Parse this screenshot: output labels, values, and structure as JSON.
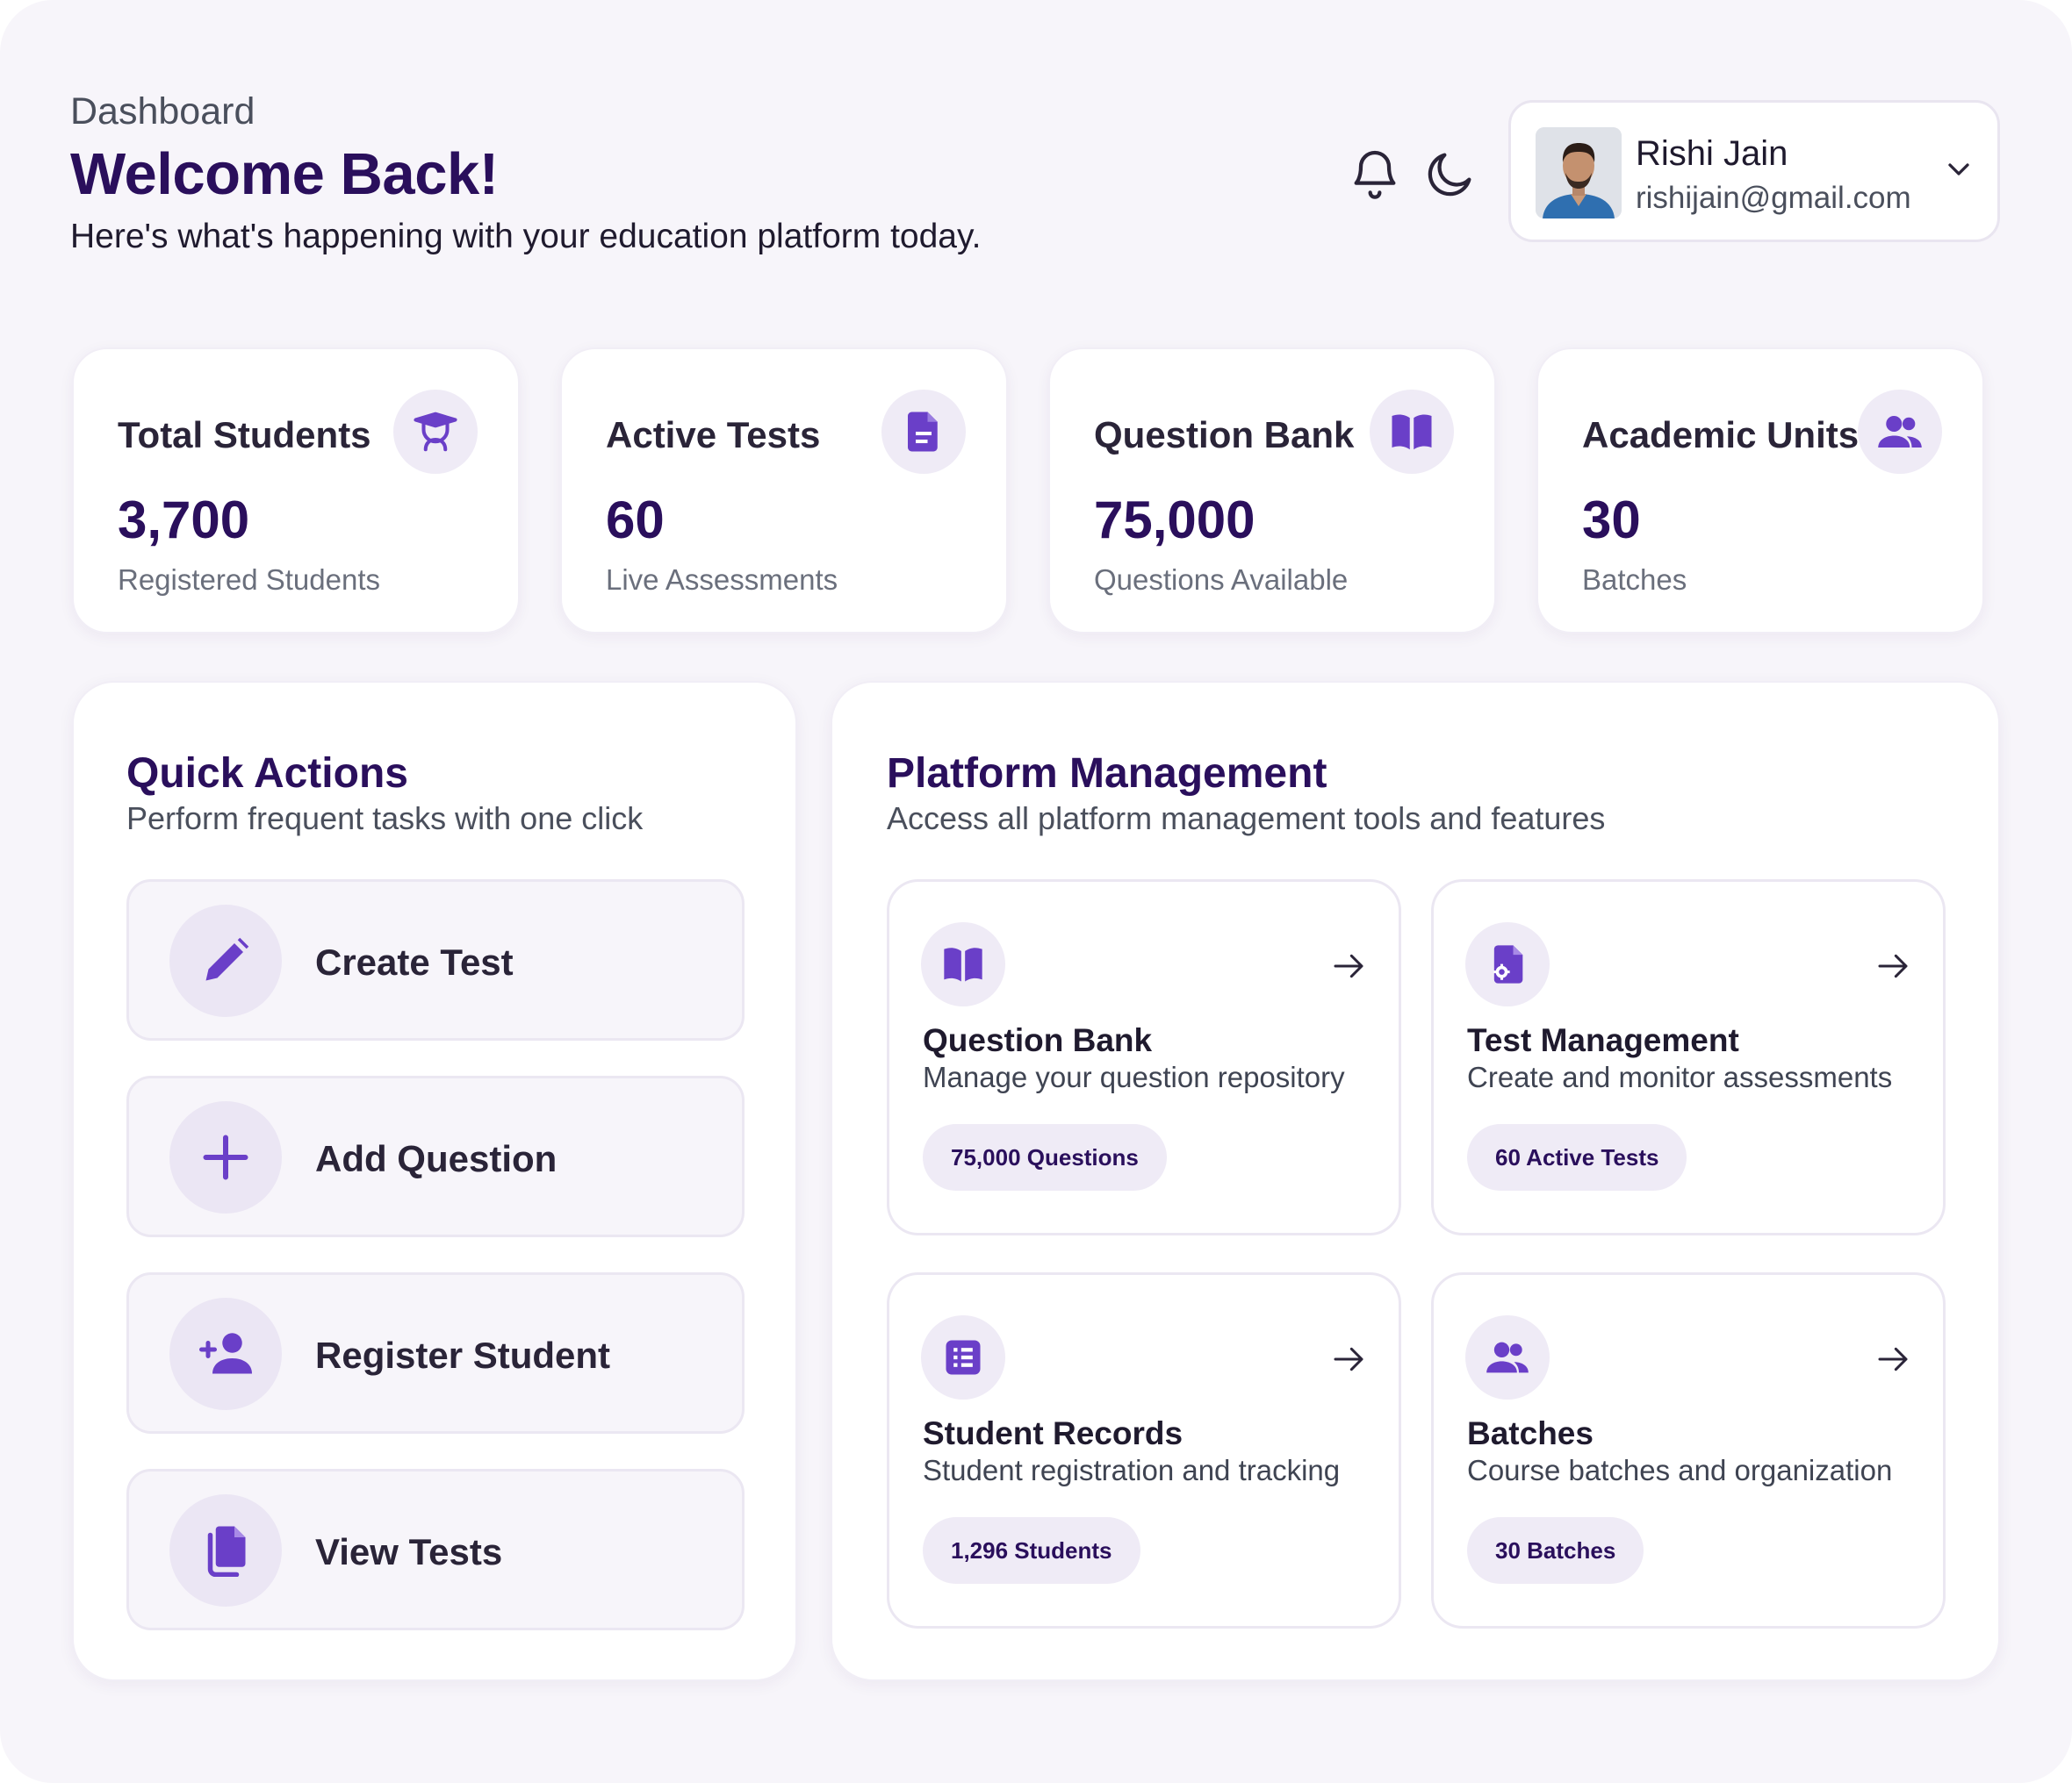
{
  "header": {
    "breadcrumb": "Dashboard",
    "title": "Welcome Back!",
    "subtitle": "Here's what's happening with your education platform today.",
    "icons": [
      "bell-icon",
      "moon-icon"
    ]
  },
  "user": {
    "name": "Rishi Jain",
    "email": "rishijain@gmail.com"
  },
  "stats": [
    {
      "title": "Total Students",
      "value": "3,700",
      "sub": "Registered Students",
      "icon": "graduate-icon"
    },
    {
      "title": "Active Tests",
      "value": "60",
      "sub": "Live Assessments",
      "icon": "document-icon"
    },
    {
      "title": "Question Bank",
      "value": "75,000",
      "sub": "Questions Available",
      "icon": "book-icon"
    },
    {
      "title": "Academic Units",
      "value": "30",
      "sub": "Batches",
      "icon": "users-icon"
    }
  ],
  "quick_actions": {
    "title": "Quick Actions",
    "subtitle": "Perform frequent tasks with one click",
    "items": [
      {
        "label": "Create Test",
        "icon": "pencil-icon"
      },
      {
        "label": "Add Question",
        "icon": "plus-icon"
      },
      {
        "label": "Register Student",
        "icon": "user-plus-icon"
      },
      {
        "label": "View Tests",
        "icon": "copy-icon"
      }
    ]
  },
  "platform": {
    "title": "Platform Management",
    "subtitle": "Access all platform management tools and features",
    "items": [
      {
        "title": "Question Bank",
        "desc": "Manage your question repository",
        "badge": "75,000 Questions",
        "icon": "book-icon"
      },
      {
        "title": "Test Management",
        "desc": "Create and monitor assessments",
        "badge": "60 Active Tests",
        "icon": "file-gear-icon"
      },
      {
        "title": "Student Records",
        "desc": "Student registration and tracking",
        "badge": "1,296 Students",
        "icon": "list-icon"
      },
      {
        "title": "Batches",
        "desc": "Course batches and organization",
        "badge": "30 Batches",
        "icon": "users-icon"
      }
    ]
  },
  "colors": {
    "accent": "#6a3fc8",
    "heading": "#2a0f5c",
    "background": "#f7f5fa",
    "icon_bg": "#efebf6"
  }
}
